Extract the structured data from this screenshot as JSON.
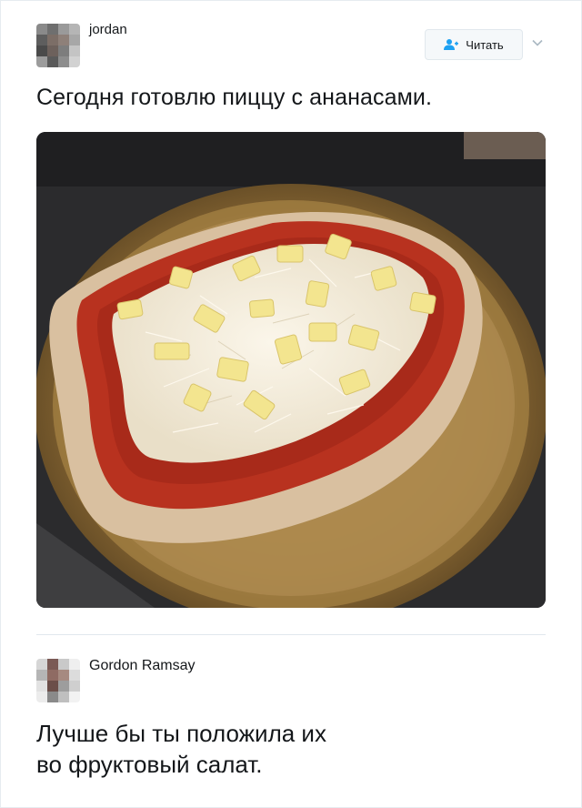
{
  "tweet": {
    "author": "jordan",
    "follow_label": "Читать",
    "text": "Сегодня готовлю пиццу с ананасами.",
    "photo_icon": "pizza-photo"
  },
  "reply": {
    "author": "Gordon Ramsay",
    "text": "Лучше бы ты положила их\nво фруктовый салат."
  },
  "colors": {
    "text": "#14171a",
    "border": "#e1e8ed",
    "button_bg": "#f5f8fa",
    "follow_icon": "#1da1f2"
  }
}
